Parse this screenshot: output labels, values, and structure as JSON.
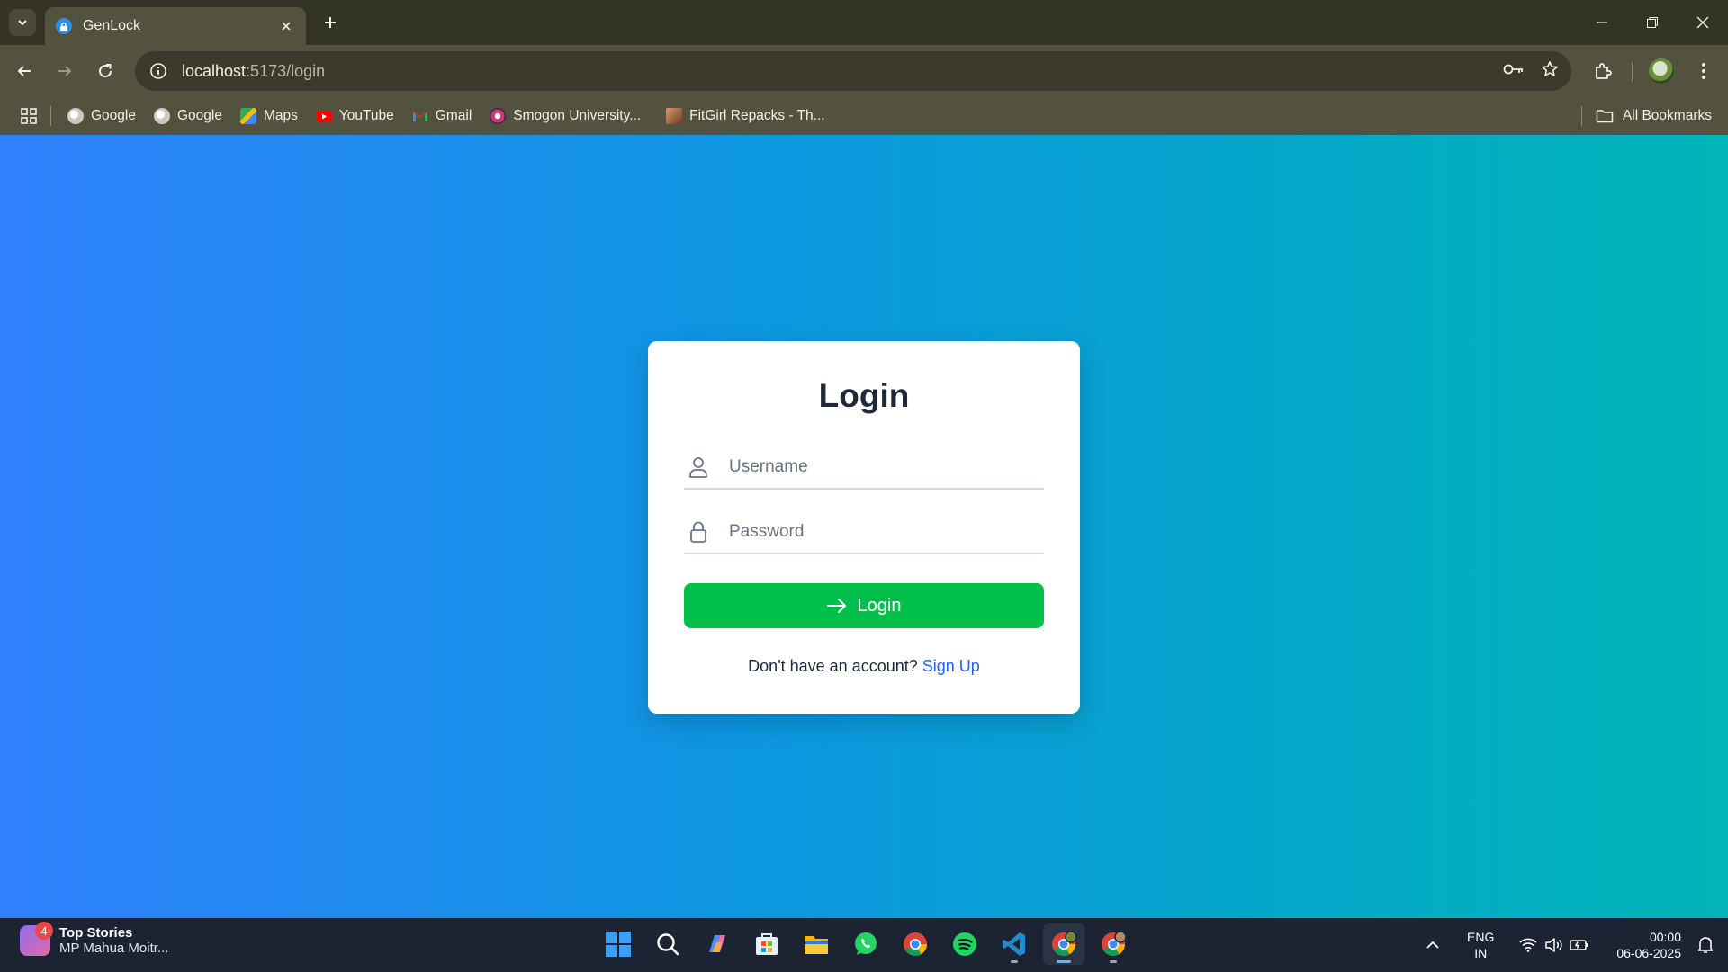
{
  "browser": {
    "tab_title": "GenLock",
    "url_host": "localhost",
    "url_path": ":5173/login",
    "bookmarks": [
      {
        "label": "Google",
        "icon": "globe-icon",
        "color": "#e8e8e0"
      },
      {
        "label": "Google",
        "icon": "globe-icon",
        "color": "#e8e8e0"
      },
      {
        "label": "Maps",
        "icon": "maps-icon",
        "color": "#34a853"
      },
      {
        "label": "YouTube",
        "icon": "youtube-icon",
        "color": "#ff0000"
      },
      {
        "label": "Gmail",
        "icon": "gmail-icon",
        "color": "#ea4335"
      },
      {
        "label": "Smogon University...",
        "icon": "smogon-icon",
        "color": "#c43a7a"
      },
      {
        "label": "FitGirl Repacks - Th...",
        "icon": "fitgirl-icon",
        "color": "#b5683f"
      }
    ],
    "all_bookmarks_label": "All Bookmarks"
  },
  "login": {
    "heading": "Login",
    "username_placeholder": "Username",
    "password_placeholder": "Password",
    "button_label": "Login",
    "signup_prompt": "Don't have an account?",
    "signup_link": "Sign Up",
    "colors": {
      "button": "#00c04b",
      "link": "#2563eb",
      "gradient_start": "#2f80fc",
      "gradient_end": "#00b4b7"
    }
  },
  "taskbar": {
    "news_count": "4",
    "news_title": "Top Stories",
    "news_subtitle": "MP Mahua Moitr...",
    "lang_line1": "ENG",
    "lang_line2": "IN",
    "time": "00:00",
    "date": "06-06-2025"
  }
}
